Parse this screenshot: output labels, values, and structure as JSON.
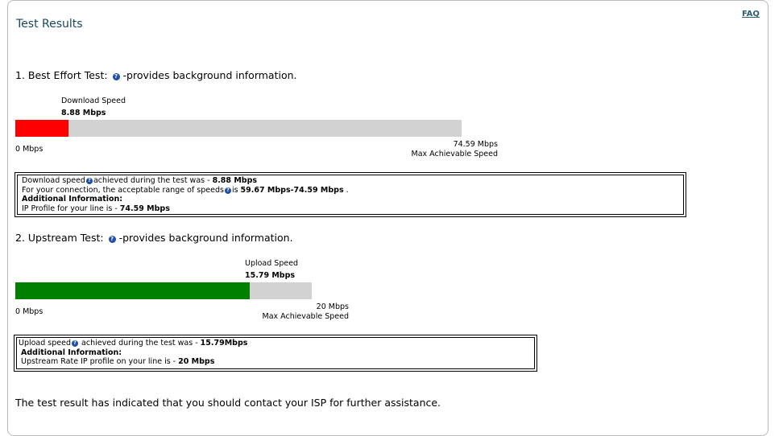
{
  "header": {
    "title": "Test Results",
    "faq_label": "FAQ"
  },
  "best_effort": {
    "heading_prefix": "1. Best Effort Test:",
    "heading_suffix": "-provides background information.",
    "speed_label": "Download Speed",
    "speed_value": "8.88 Mbps",
    "scale_min": "0 Mbps",
    "scale_max": "74.59 Mbps",
    "scale_max_caption": "Max Achievable Speed",
    "fill_fraction": 0.119,
    "fill_color": "#ff0000",
    "info": {
      "line1_prefix": "Download speed",
      "line1_middle": "achieved during the test was - ",
      "line1_value": "8.88 Mbps",
      "line2_prefix": "For your connection, the acceptable range of speeds",
      "line2_middle": "is ",
      "line2_value": "59.67 Mbps-74.59 Mbps",
      "line2_suffix": " .",
      "additional_label": "Additional Information:",
      "line4_prefix": "IP Profile for your line is - ",
      "line4_value": "74.59 Mbps"
    }
  },
  "upstream": {
    "heading_prefix": "2. Upstream Test:",
    "heading_suffix": "-provides background information.",
    "speed_label": "Upload Speed",
    "speed_value": "15.79 Mbps",
    "scale_min": "0 Mbps",
    "scale_max": "20 Mbps",
    "scale_max_caption": "Max Achievable Speed",
    "fill_fraction": 0.7895,
    "fill_color": "#008000",
    "info": {
      "line1_prefix": "Upload speed",
      "line1_middle": " achieved during the test was - ",
      "line1_value": "15.79Mbps",
      "additional_label": "Additional Information:",
      "line3_prefix": "Upstream Rate IP profile on your line is - ",
      "line3_value": "20 Mbps"
    }
  },
  "footer": {
    "message": "The test result has indicated that you should contact your ISP for further assistance."
  },
  "icons": {
    "help": "question-circle-icon"
  }
}
